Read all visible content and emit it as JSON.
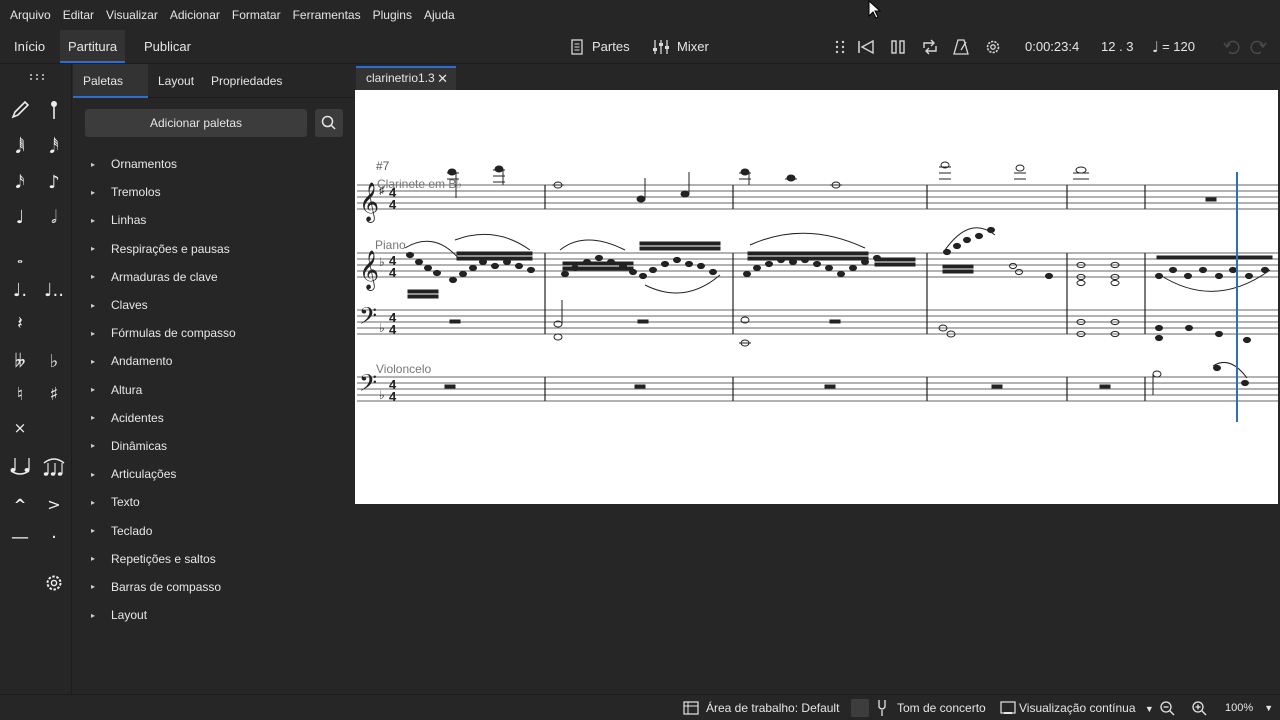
{
  "menu": [
    "Arquivo",
    "Editar",
    "Visualizar",
    "Adicionar",
    "Formatar",
    "Ferramentas",
    "Plugins",
    "Ajuda"
  ],
  "toolbar": {
    "tabs": [
      "Início",
      "Partitura",
      "Publicar"
    ],
    "parts_label": "Partes",
    "mixer_label": "Mixer",
    "time": "0:00:23:4",
    "position": "12 . 3",
    "tempo": "= 120"
  },
  "tools": {
    "icons": [
      "pencil-icon",
      "pin-icon",
      "64th-note-icon",
      "32nd-note-icon",
      "16th-note-icon",
      "eighth-note-icon",
      "quarter-note-icon",
      "half-note-icon",
      "whole-note-icon",
      "dotted-quarter-icon",
      "double-dotted-icon",
      "quarter-rest-icon",
      "double-flat-icon",
      "flat-icon",
      "natural-icon",
      "sharp-icon",
      "double-sharp-icon",
      "tie-icon",
      "slur-icon",
      "marcato-icon",
      "accent-icon",
      "tenuto-icon",
      "staccato-icon",
      "gear-icon"
    ]
  },
  "panel": {
    "tabs": [
      "Paletas",
      "Layout",
      "Propriedades"
    ],
    "add_label": "Adicionar paletas",
    "items": [
      "Ornamentos",
      "Tremolos",
      "Linhas",
      "Respirações e pausas",
      "Armaduras de clave",
      "Claves",
      "Fórmulas de compasso",
      "Andamento",
      "Altura",
      "Acidentes",
      "Dinâmicas",
      "Articulações",
      "Texto",
      "Teclado",
      "Repetições e saltos",
      "Barras de compasso",
      "Layout"
    ]
  },
  "score": {
    "tab_name": "clarinetrio1.3",
    "measure_label": "#7",
    "instruments": [
      "Clarinete em B♭",
      "Piano",
      "Violoncelo"
    ]
  },
  "status": {
    "workspace": "Área de trabalho: Default",
    "concert_pitch": "Tom de concerto",
    "view_mode": "Visualização contínua",
    "zoom": "100%"
  },
  "colors": {
    "accent": "#2d6ed4",
    "background": "#262626",
    "panel_button": "#3c3c3c",
    "playback_cursor": "#2f6fb5"
  }
}
